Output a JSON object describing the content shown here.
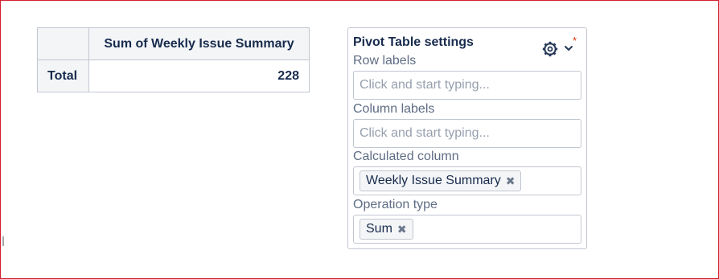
{
  "pivot_table": {
    "column_header": "Sum of Weekly Issue Summary",
    "row_header": "Total",
    "total_value": "228"
  },
  "settings": {
    "title": "Pivot Table settings",
    "required_marker": "*",
    "row_labels": {
      "label": "Row labels",
      "placeholder": "Click and start typing..."
    },
    "column_labels": {
      "label": "Column labels",
      "placeholder": "Click and start typing..."
    },
    "calculated_column": {
      "label": "Calculated column",
      "value": "Weekly Issue Summary"
    },
    "operation_type": {
      "label": "Operation type",
      "value": "Sum"
    },
    "remove_glyph": "✖",
    "icons": {
      "settings": "gear-icon",
      "expand": "chevron-down-icon"
    }
  },
  "colors": {
    "frame_border": "#d21f2a",
    "text_primary": "#172b4d",
    "label_text": "#5e6c84",
    "placeholder_text": "#97a0af",
    "border": "#c1c7d0",
    "header_bg": "#f4f5f7",
    "required": "#de350b"
  }
}
